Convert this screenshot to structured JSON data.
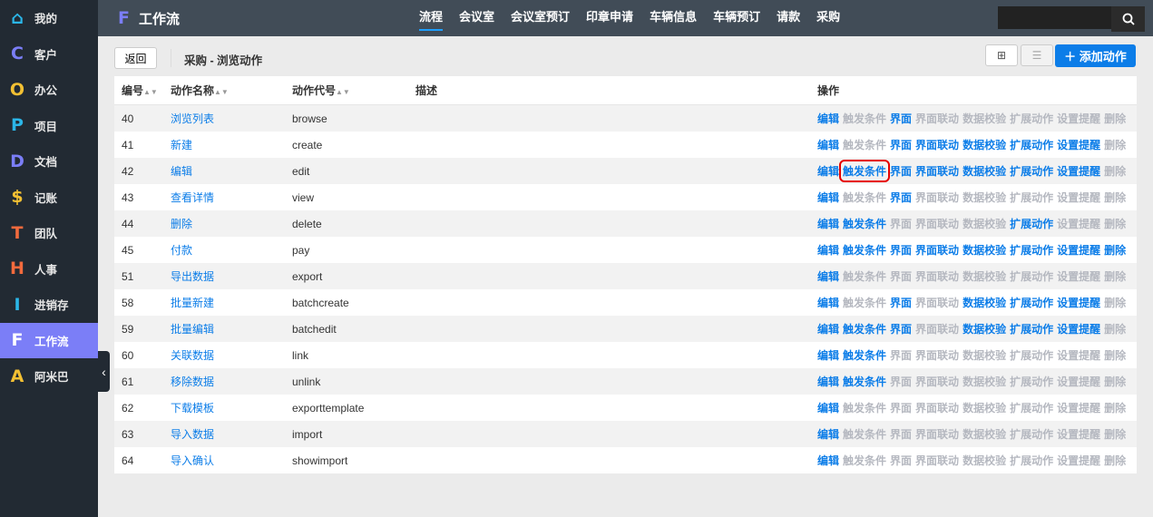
{
  "sidebar": {
    "items": [
      {
        "icon": "⌂",
        "label": "我的",
        "color": "#2bb6e8",
        "name": "home-icon"
      },
      {
        "icon": "C",
        "label": "客户",
        "color": "#7b7ef7",
        "name": "c-icon"
      },
      {
        "icon": "O",
        "label": "办公",
        "color": "#f3c033",
        "name": "o-icon"
      },
      {
        "icon": "P",
        "label": "项目",
        "color": "#2bb6e8",
        "name": "p-icon"
      },
      {
        "icon": "D",
        "label": "文档",
        "color": "#7b7ef7",
        "name": "d-icon"
      },
      {
        "icon": "$",
        "label": "记账",
        "color": "#f3c033",
        "name": "dollar-icon"
      },
      {
        "icon": "T",
        "label": "团队",
        "color": "#f26a3d",
        "name": "t-icon"
      },
      {
        "icon": "H",
        "label": "人事",
        "color": "#f26a3d",
        "name": "h-icon"
      },
      {
        "icon": "I",
        "label": "进销存",
        "color": "#2bb6e8",
        "name": "i-icon"
      },
      {
        "icon": "F",
        "label": "工作流",
        "color": "#ffffff",
        "name": "f-icon",
        "active": true
      },
      {
        "icon": "A",
        "label": "阿米巴",
        "color": "#f3c033",
        "name": "a-icon"
      }
    ]
  },
  "header": {
    "logo": "F",
    "title": "工作流",
    "nav": [
      "流程",
      "会议室",
      "会议室预订",
      "印章申请",
      "车辆信息",
      "车辆预订",
      "请款",
      "采购"
    ],
    "active_nav": 0,
    "search_placeholder": ""
  },
  "toolbar": {
    "back": "返回",
    "breadcrumb": "采购 - 浏览动作",
    "add": "添加动作"
  },
  "table": {
    "headers": {
      "id": "编号",
      "name": "动作名称",
      "code": "动作代号",
      "desc": "描述",
      "ops": "操作"
    },
    "op_labels": [
      "编辑",
      "触发条件",
      "界面",
      "界面联动",
      "数据校验",
      "扩展动作",
      "设置提醒",
      "删除"
    ],
    "rows": [
      {
        "id": "40",
        "name": "浏览列表",
        "code": "browse",
        "desc": "",
        "ops": [
          1,
          0,
          1,
          0,
          0,
          0,
          0,
          0
        ]
      },
      {
        "id": "41",
        "name": "新建",
        "code": "create",
        "desc": "",
        "ops": [
          1,
          0,
          1,
          1,
          1,
          1,
          1,
          0
        ]
      },
      {
        "id": "42",
        "name": "编辑",
        "code": "edit",
        "desc": "",
        "ops": [
          1,
          1,
          1,
          1,
          1,
          1,
          1,
          0
        ],
        "highlight": 1
      },
      {
        "id": "43",
        "name": "查看详情",
        "code": "view",
        "desc": "",
        "ops": [
          1,
          0,
          1,
          0,
          0,
          0,
          0,
          0
        ]
      },
      {
        "id": "44",
        "name": "删除",
        "code": "delete",
        "desc": "",
        "ops": [
          1,
          1,
          0,
          0,
          0,
          1,
          0,
          0
        ]
      },
      {
        "id": "45",
        "name": "付款",
        "code": "pay",
        "desc": "",
        "ops": [
          1,
          1,
          1,
          1,
          1,
          1,
          1,
          1
        ]
      },
      {
        "id": "51",
        "name": "导出数据",
        "code": "export",
        "desc": "",
        "ops": [
          1,
          0,
          0,
          0,
          0,
          0,
          0,
          0
        ]
      },
      {
        "id": "58",
        "name": "批量新建",
        "code": "batchcreate",
        "desc": "",
        "ops": [
          1,
          0,
          1,
          0,
          1,
          1,
          1,
          0
        ]
      },
      {
        "id": "59",
        "name": "批量编辑",
        "code": "batchedit",
        "desc": "",
        "ops": [
          1,
          1,
          1,
          0,
          1,
          1,
          1,
          0
        ]
      },
      {
        "id": "60",
        "name": "关联数据",
        "code": "link",
        "desc": "",
        "ops": [
          1,
          1,
          0,
          0,
          0,
          0,
          0,
          0
        ]
      },
      {
        "id": "61",
        "name": "移除数据",
        "code": "unlink",
        "desc": "",
        "ops": [
          1,
          1,
          0,
          0,
          0,
          0,
          0,
          0
        ]
      },
      {
        "id": "62",
        "name": "下载模板",
        "code": "exporttemplate",
        "desc": "",
        "ops": [
          1,
          0,
          0,
          0,
          0,
          0,
          0,
          0
        ]
      },
      {
        "id": "63",
        "name": "导入数据",
        "code": "import",
        "desc": "",
        "ops": [
          1,
          0,
          0,
          0,
          0,
          0,
          0,
          0
        ]
      },
      {
        "id": "64",
        "name": "导入确认",
        "code": "showimport",
        "desc": "",
        "ops": [
          1,
          0,
          0,
          0,
          0,
          0,
          0,
          0
        ]
      }
    ]
  },
  "colors": {
    "accent": "#0c7de8",
    "sidebar_active": "#7b7ef7",
    "disabled": "#b5b8c0",
    "highlight_box": "#e60000"
  }
}
